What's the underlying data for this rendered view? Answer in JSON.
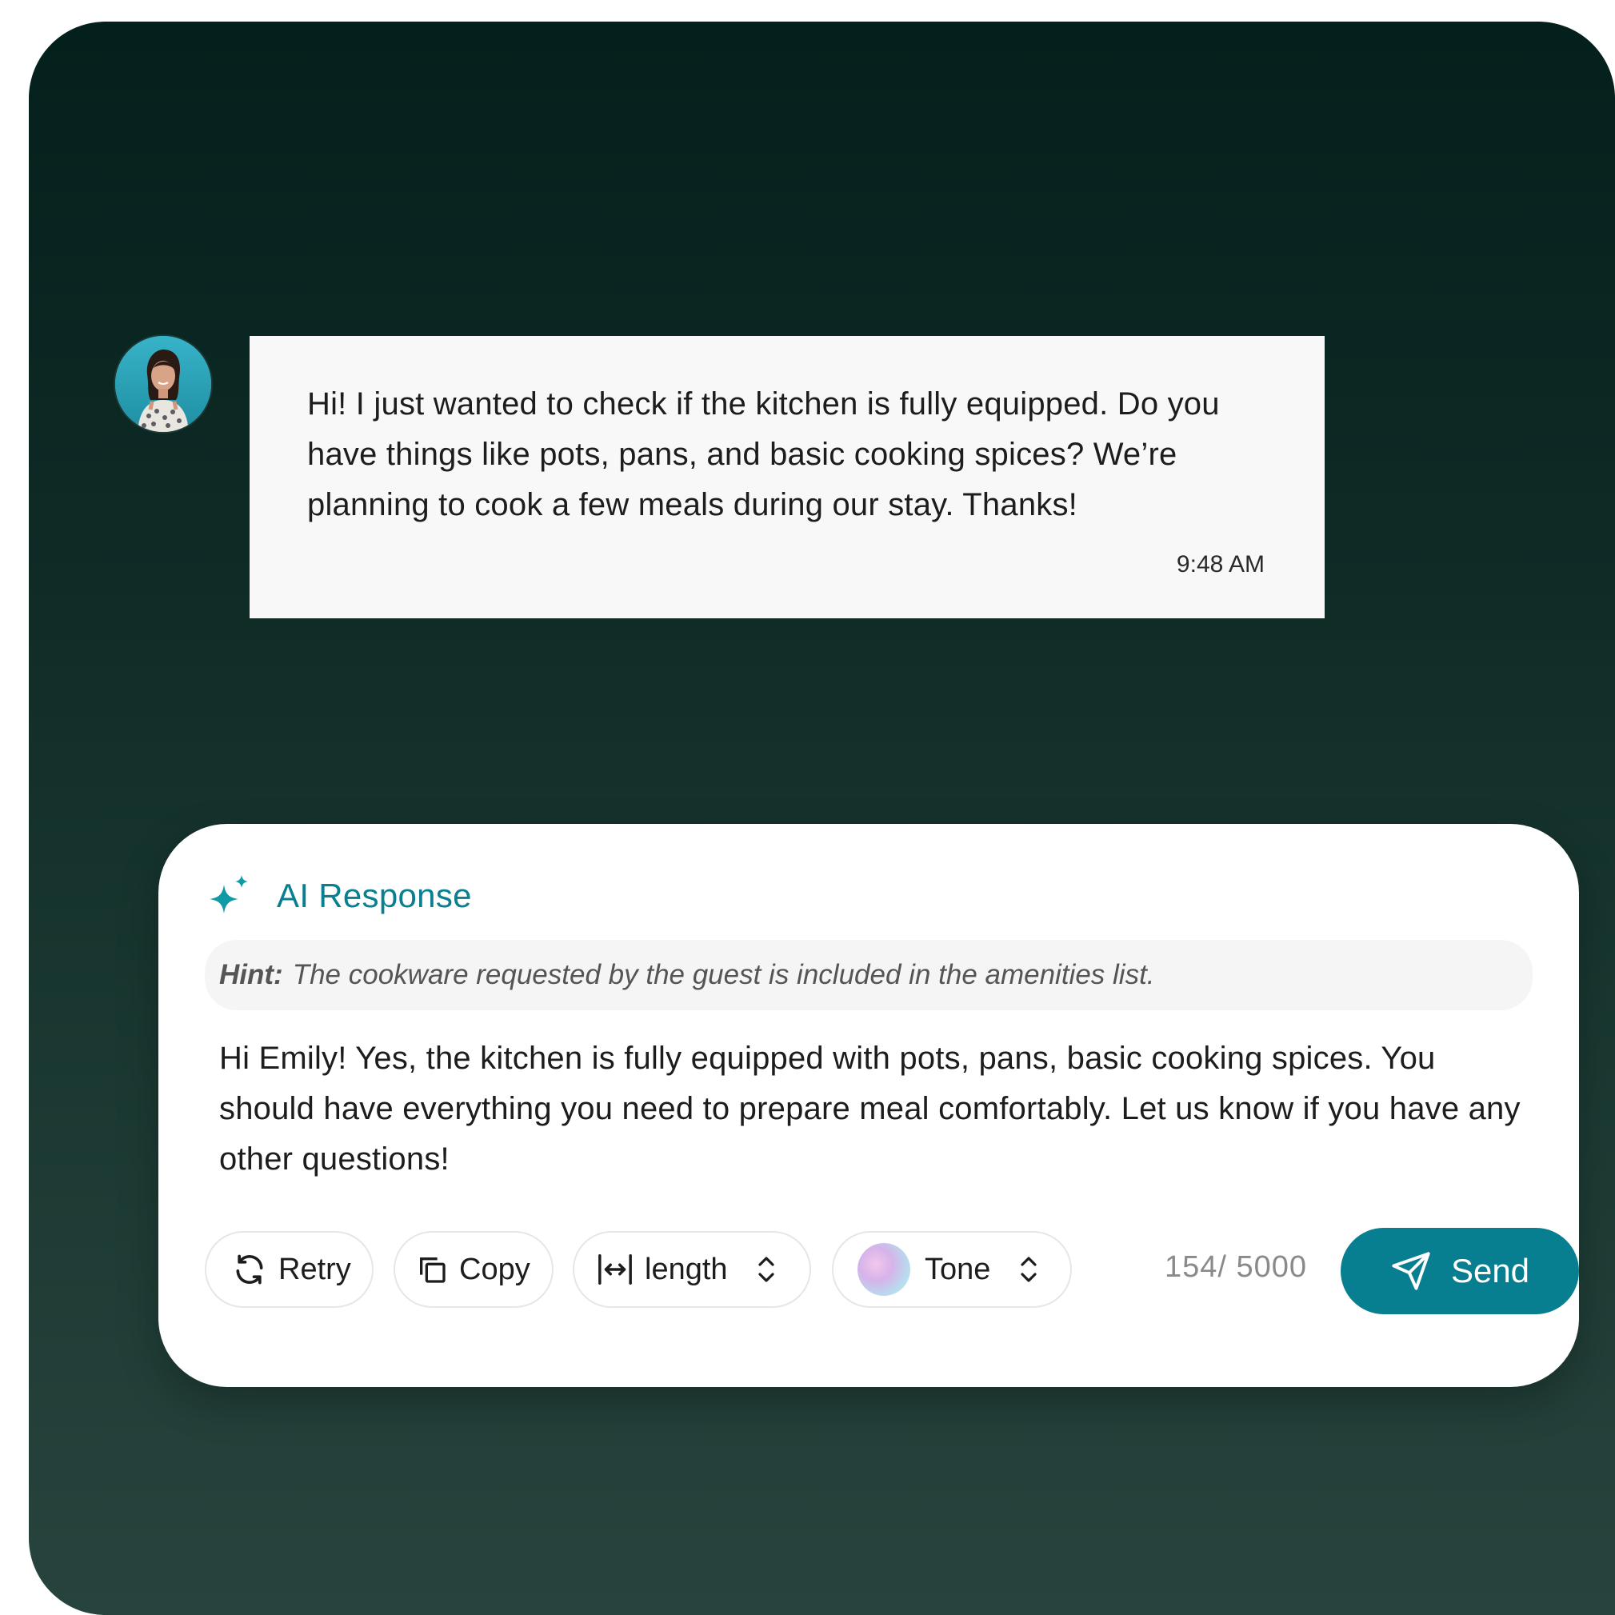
{
  "guest_message": {
    "text": "Hi! I just wanted to check if the kitchen is fully equipped. Do you have things like pots, pans, and basic cooking spices? We’re planning to cook a few meals during our stay. Thanks!",
    "time": "9:48 AM"
  },
  "ai_response": {
    "title": "AI Response",
    "hint_label": "Hint:",
    "hint_text": "The cookware requested by the guest is included in the amenities list.",
    "body": "Hi Emily! Yes, the kitchen is fully equipped with pots, pans, basic cooking spices. You should have everything you need to prepare meal comfortably. Let us know if you have any other questions!",
    "actions": {
      "retry": "Retry",
      "copy": "Copy",
      "length": "length",
      "tone": "Tone",
      "send": "Send"
    },
    "counter": "154/ 5000"
  },
  "colors": {
    "accent": "#087f90",
    "background_top": "#04201c",
    "background_bottom": "#27433d"
  },
  "icons": [
    "avatar",
    "sparkle-icon",
    "refresh-icon",
    "copy-icon",
    "width-arrows-icon",
    "chevron-updown-icon",
    "tone-orb",
    "paper-plane-icon"
  ]
}
